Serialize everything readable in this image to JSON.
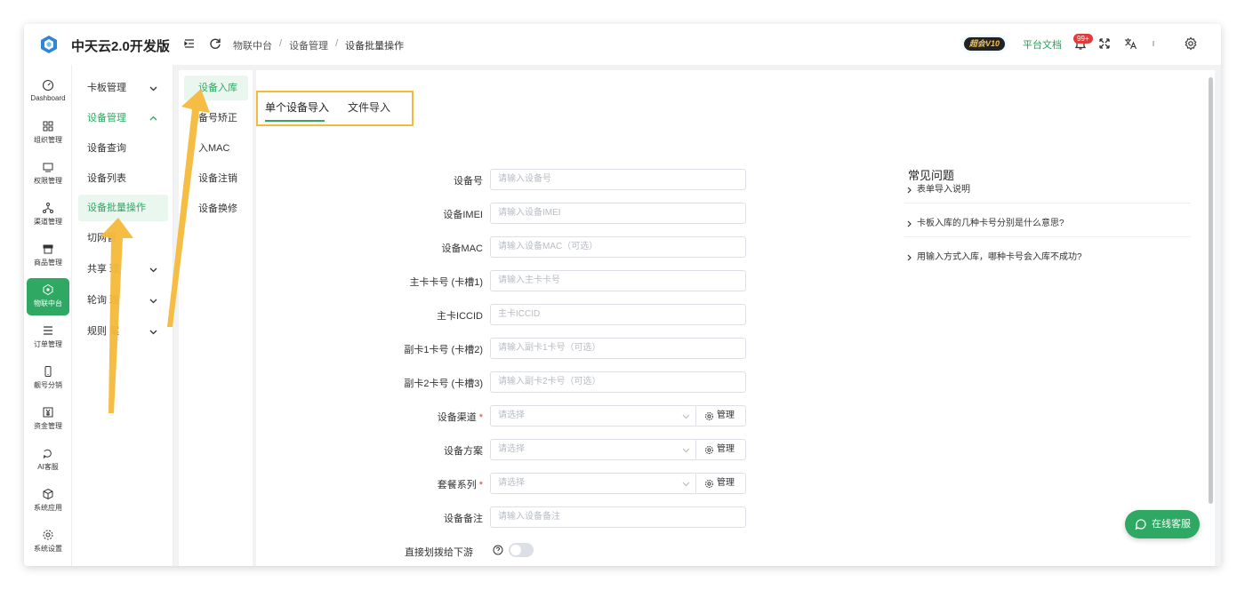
{
  "brand": {
    "title": "中天云2.0开发版"
  },
  "breadcrumb": {
    "items": [
      "物联中台",
      "设备管理",
      "设备批量操作"
    ]
  },
  "header": {
    "vip": "超会V10",
    "doc_link": "平台文档",
    "badge": "99+"
  },
  "side_icons": [
    {
      "label": "Dashboard",
      "icon": "dashboard-icon"
    },
    {
      "label": "组织管理",
      "icon": "grid-icon"
    },
    {
      "label": "权限管理",
      "icon": "monitor-icon"
    },
    {
      "label": "渠道管理",
      "icon": "branch-icon"
    },
    {
      "label": "商品管理",
      "icon": "shop-icon"
    },
    {
      "label": "物联中台",
      "icon": "cube-icon",
      "active": true
    },
    {
      "label": "订单管理",
      "icon": "list-icon"
    },
    {
      "label": "靓号分销",
      "icon": "phone-icon"
    },
    {
      "label": "资金管理",
      "icon": "money-icon"
    },
    {
      "label": "AI客服",
      "icon": "ai-icon"
    },
    {
      "label": "系统应用",
      "icon": "box-icon"
    },
    {
      "label": "系统设置",
      "icon": "settings-icon"
    }
  ],
  "side_menu": [
    {
      "label": "卡板管理",
      "chevron": "down"
    },
    {
      "label": "设备管理",
      "chevron": "up",
      "state": "open"
    },
    {
      "label": "设备查询"
    },
    {
      "label": "设备列表"
    },
    {
      "label": "设备批量操作",
      "state": "active"
    },
    {
      "label": "切网管"
    },
    {
      "label": "共享 理",
      "chevron": "down"
    },
    {
      "label": "轮询 理",
      "chevron": "down"
    },
    {
      "label": "规则 案",
      "chevron": "down"
    }
  ],
  "sub_menu": [
    {
      "label": "设备入库",
      "active": true
    },
    {
      "label": "备号矫正"
    },
    {
      "label": "入MAC"
    },
    {
      "label": "设备注销"
    },
    {
      "label": "设备换修"
    }
  ],
  "tabs": [
    {
      "label": "单个设备导入",
      "active": true
    },
    {
      "label": "文件导入"
    }
  ],
  "form": [
    {
      "label": "设备号",
      "placeholder": "请输入设备号",
      "type": "input"
    },
    {
      "label": "设备IMEI",
      "placeholder": "请输入设备IMEI",
      "type": "input"
    },
    {
      "label": "设备MAC",
      "placeholder": "请输入设备MAC（可选）",
      "type": "input"
    },
    {
      "label": "主卡卡号 (卡槽1)",
      "placeholder": "请输入主卡卡号",
      "type": "input"
    },
    {
      "label": "主卡ICCID",
      "placeholder": "主卡ICCID",
      "type": "input"
    },
    {
      "label": "副卡1卡号 (卡槽2)",
      "placeholder": "请输入副卡1卡号（可选）",
      "type": "input"
    },
    {
      "label": "副卡2卡号 (卡槽3)",
      "placeholder": "请输入副卡2卡号（可选）",
      "type": "input"
    },
    {
      "label": "设备渠道",
      "placeholder": "请选择",
      "type": "select",
      "required": true,
      "manage": "管理"
    },
    {
      "label": "设备方案",
      "placeholder": "请选择",
      "type": "select",
      "manage": "管理"
    },
    {
      "label": "套餐系列",
      "placeholder": "请选择",
      "type": "select",
      "required": true,
      "manage": "管理"
    },
    {
      "label": "设备备注",
      "placeholder": "请输入设备备注",
      "type": "input"
    },
    {
      "label": "直接划拨给下游",
      "type": "toggle",
      "value": false
    }
  ],
  "faq": {
    "title": "常见问题",
    "items": [
      "表单导入说明",
      "卡板入库的几种卡号分别是什么意思?",
      "用输入方式入库，哪种卡号会入库不成功?"
    ]
  },
  "chat": {
    "label": "在线客服"
  },
  "colors": {
    "accent": "#2ea862",
    "highlight": "#f6b93b",
    "badge": "#e23b3b"
  }
}
